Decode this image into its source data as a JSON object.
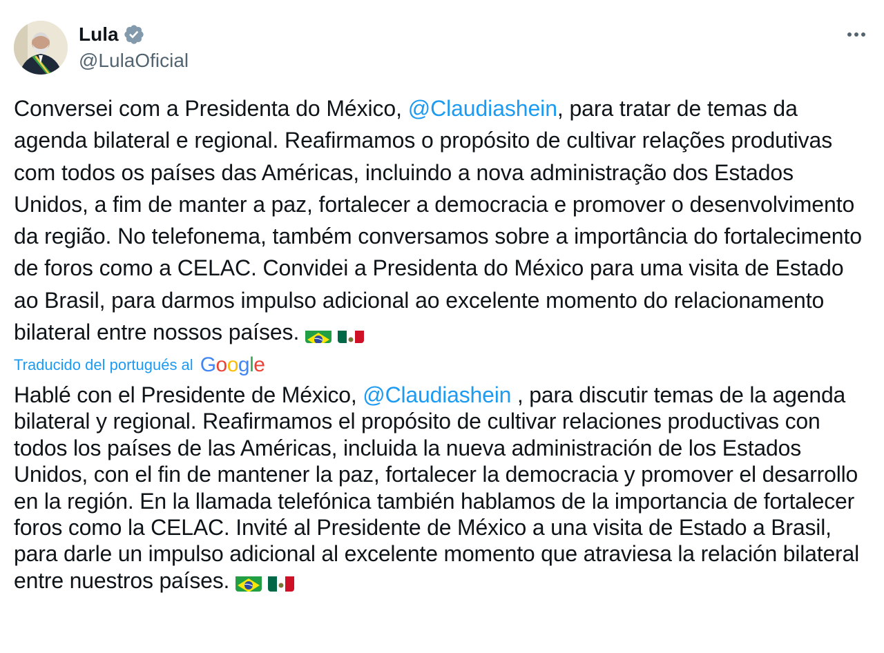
{
  "author": {
    "display_name": "Lula",
    "handle": "@LulaOficial",
    "verified_icon": "verified-badge-icon",
    "verified_color": "#829aab",
    "avatar_icon": "avatar"
  },
  "menu": {
    "icon": "more-options-icon"
  },
  "tweet": {
    "original": {
      "before_mention": "Conversei com a Presidenta do México, ",
      "mention": "@Claudiashein",
      "after_mention": ", para tratar de temas da agenda bilateral e regional. Reafirmamos o propósito de cultivar relações produtivas com todos os países das Américas, incluindo a nova administração dos Estados Unidos, a fim de manter a paz, fortalecer a democracia e promover o desenvolvimento da região. No telefonema, também conversamos sobre a importância do fortalecimento de foros como a CELAC. Convidei a Presidenta do México para uma visita de Estado ao Brasil, para darmos impulso adicional ao excelente momento do relacionamento bilateral entre nossos países. "
    },
    "translation_label": "Traducido del portugués al",
    "translation_provider": [
      "G",
      "o",
      "o",
      "g",
      "l",
      "e"
    ],
    "translated": {
      "before_mention": "Hablé con el Presidente de México, ",
      "mention": "@Claudiashein",
      "after_mention": " , para discutir temas de la agenda bilateral y regional. Reafirmamos el propósito de cultivar relaciones productivas con todos los países de las Américas, incluida la nueva administración de los Estados Unidos, con el fin de mantener la paz, fortalecer la democracia y promover el desarrollo en la región. En la llamada telefónica también hablamos de la importancia de fortalecer foros como la CELAC. Invité al Presidente de México a una visita de Estado a Brasil, para darle un impulso adicional al excelente momento que atraviesa la relación bilateral entre nuestros países. "
    },
    "flags": [
      "brazil-flag-icon",
      "mexico-flag-icon"
    ]
  },
  "colors": {
    "link": "#1d9bf0",
    "text": "#0f1419",
    "secondary": "#536471",
    "google": [
      "#4285f4",
      "#ea4335",
      "#fbbc05",
      "#4285f4",
      "#34a853",
      "#ea4335"
    ]
  }
}
